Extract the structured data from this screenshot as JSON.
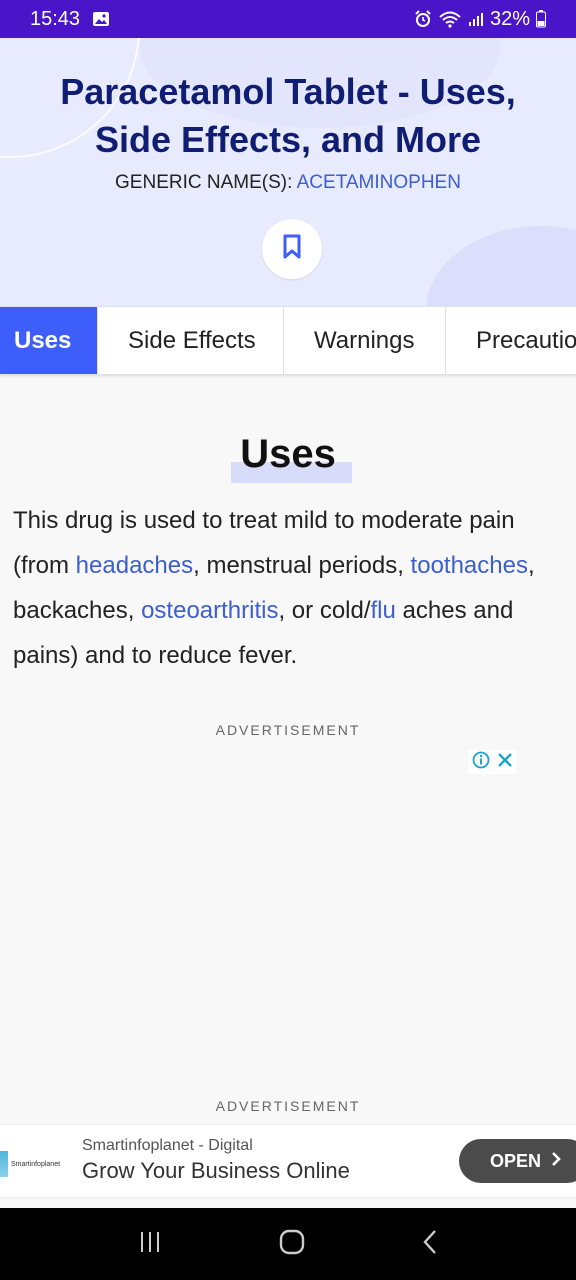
{
  "status_bar": {
    "time": "15:43",
    "battery": "32%",
    "icons": [
      "image-icon",
      "alarm-icon",
      "wifi-icon",
      "signal-icon",
      "battery-icon"
    ]
  },
  "header": {
    "title": "Paracetamol Tablet - Uses, Side Effects, and More",
    "generic_label": "GENERIC NAME(S):",
    "generic_value": "ACETAMINOPHEN",
    "bookmark_icon": "bookmark-icon"
  },
  "tabs": [
    {
      "label": "Uses",
      "active": true
    },
    {
      "label": "Side Effects",
      "active": false
    },
    {
      "label": "Warnings",
      "active": false
    },
    {
      "label": "Precautions",
      "active": false
    }
  ],
  "content": {
    "section_title": "Uses",
    "text": {
      "p1": "This drug is used to treat mild to moderate pain (from ",
      "link1": "headaches",
      "p2": ", menstrual periods, ",
      "link2": "toothaches",
      "p3": ", backaches, ",
      "link3": "osteoarthritis",
      "p4": ", or cold/",
      "link4": "flu",
      "p5": " aches and pains) and to reduce fever."
    },
    "ad_label": "ADVERTISEMENT",
    "ad_label_2": "ADVERTISEMENT"
  },
  "banner_ad": {
    "logo_text": "Smartinfoplanet",
    "advertiser": "Smartinfoplanet - Digital",
    "headline": "Grow Your Business Online",
    "button_label": "OPEN",
    "colors": {
      "button_bg": "#4b4b4b"
    }
  },
  "colors": {
    "status_bar": "#4a14c8",
    "title": "#0f1e72",
    "link": "#3d5ed0",
    "active_tab": "#3d5efb",
    "header_bg": "#e8eafd"
  }
}
